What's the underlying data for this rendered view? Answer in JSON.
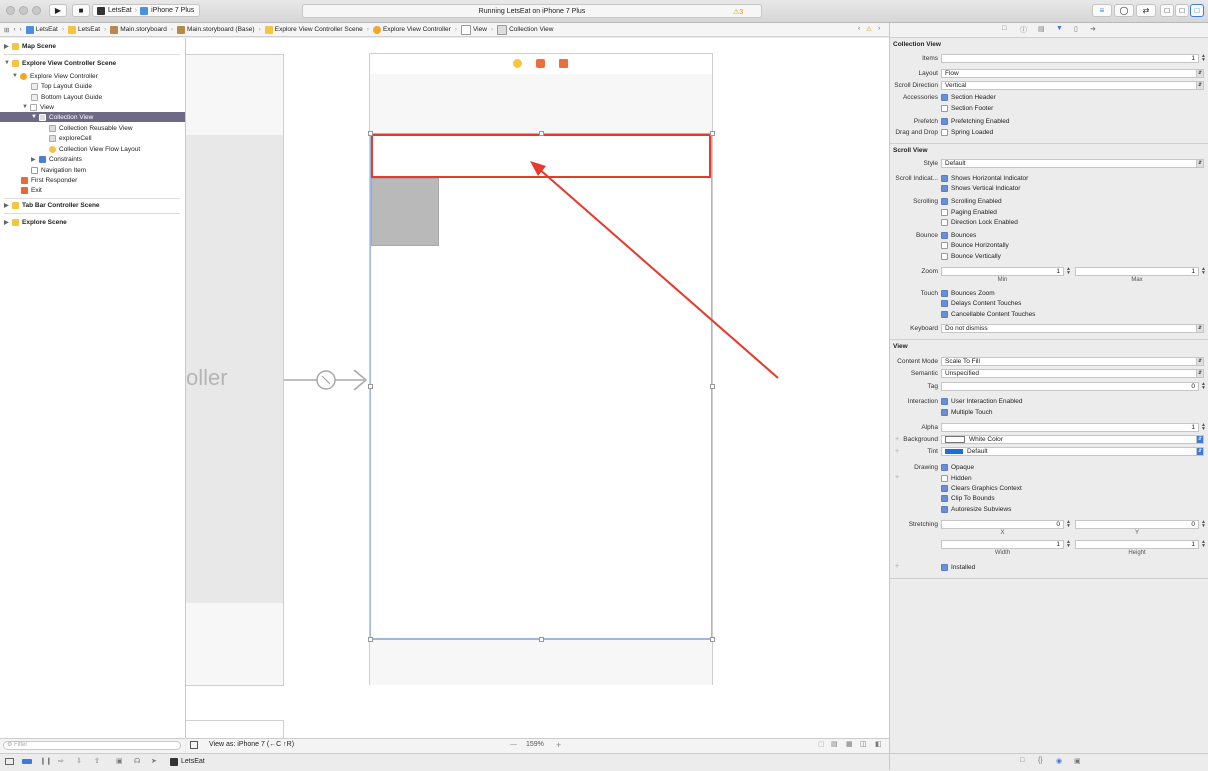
{
  "toolbar": {
    "scheme_app": "LetsEat",
    "scheme_device": "iPhone 7 Plus",
    "activity_text": "Running LetsEat on iPhone 7 Plus",
    "warning_count": "3"
  },
  "jumpbar": {
    "items": [
      "LetsEat",
      "LetsEat",
      "Main.storyboard",
      "Main.storyboard (Base)",
      "Explore View Controller Scene",
      "Explore View Controller",
      "View",
      "Collection View"
    ],
    "warning_count": "1"
  },
  "outline": {
    "map_scene": "Map Scene",
    "explore_scene_header": "Explore View Controller Scene",
    "explore_vc": "Explore View Controller",
    "top_layout_guide": "Top Layout Guide",
    "bottom_layout_guide": "Bottom Layout Guide",
    "view": "View",
    "collection_view": "Collection View",
    "collection_reusable_view": "Collection Reusable View",
    "explore_cell": "exploreCell",
    "flow_layout": "Collection View Flow Layout",
    "constraints": "Constraints",
    "navigation_item": "Navigation Item",
    "first_responder": "First Responder",
    "exit": "Exit",
    "tab_bar_scene": "Tab Bar Controller Scene",
    "explore_scene": "Explore Scene"
  },
  "canvas": {
    "partial_title": "oller"
  },
  "bottombar": {
    "filter_placeholder": "Filter",
    "view_as": "View as: iPhone 7 (←C ↑R)",
    "zoom": "159%",
    "zoom_minus": "—",
    "zoom_plus": "+",
    "debug_app": "LetsEat"
  },
  "inspector": {
    "collection_view": {
      "title": "Collection View",
      "items_label": "Items",
      "items_value": "1",
      "layout_label": "Layout",
      "layout_value": "Flow",
      "scroll_direction_label": "Scroll Direction",
      "scroll_direction_value": "Vertical",
      "accessories_label": "Accessories",
      "section_header": "Section Header",
      "section_footer": "Section Footer",
      "prefetch_label": "Prefetch",
      "prefetching_enabled": "Prefetching Enabled",
      "drag_drop_label": "Drag and Drop",
      "spring_loaded": "Spring Loaded"
    },
    "scroll_view": {
      "title": "Scroll View",
      "style_label": "Style",
      "style_value": "Default",
      "scroll_indicators_label": "Scroll Indicat...",
      "shows_horizontal": "Shows Horizontal Indicator",
      "shows_vertical": "Shows Vertical Indicator",
      "scrolling_label": "Scrolling",
      "scrolling_enabled": "Scrolling Enabled",
      "paging_enabled": "Paging Enabled",
      "direction_lock": "Direction Lock Enabled",
      "bounce_label": "Bounce",
      "bounces": "Bounces",
      "bounce_horizontally": "Bounce Horizontally",
      "bounce_vertically": "Bounce Vertically",
      "zoom_label": "Zoom",
      "zoom_min": "1",
      "zoom_max": "1",
      "min_label": "Min",
      "max_label": "Max",
      "touch_label": "Touch",
      "bounces_zoom": "Bounces Zoom",
      "delays_content": "Delays Content Touches",
      "cancellable_content": "Cancellable Content Touches",
      "keyboard_label": "Keyboard",
      "keyboard_value": "Do not dismiss"
    },
    "view": {
      "title": "View",
      "content_mode_label": "Content Mode",
      "content_mode_value": "Scale To Fill",
      "semantic_label": "Semantic",
      "semantic_value": "Unspecified",
      "tag_label": "Tag",
      "tag_value": "0",
      "interaction_label": "Interaction",
      "user_interaction": "User Interaction Enabled",
      "multiple_touch": "Multiple Touch",
      "alpha_label": "Alpha",
      "alpha_value": "1",
      "background_label": "Background",
      "background_value": "White Color",
      "tint_label": "Tint",
      "tint_value": "Default",
      "drawing_label": "Drawing",
      "opaque": "Opaque",
      "hidden": "Hidden",
      "clears_graphics": "Clears Graphics Context",
      "clip_to_bounds": "Clip To Bounds",
      "autoresize": "Autoresize Subviews",
      "stretching_label": "Stretching",
      "stretch_x": "0",
      "stretch_y": "0",
      "stretch_w": "1",
      "stretch_h": "1",
      "x_label": "X",
      "y_label": "Y",
      "width_label": "Width",
      "height_label": "Height",
      "installed": "Installed"
    }
  },
  "colors": {
    "selection": "#6e6a85",
    "annotation_red": "#e8392d",
    "accent_blue": "#3d7bd9",
    "storyboard_orange": "#f5a623"
  }
}
